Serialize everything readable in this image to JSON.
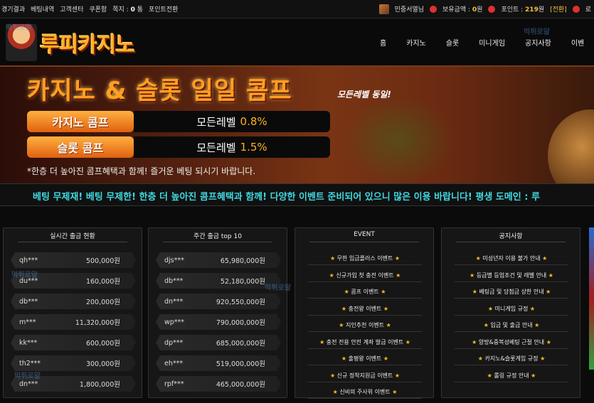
{
  "topbar": {
    "links": [
      "경기결과",
      "베팅내역",
      "고객센터",
      "쿠폰함",
      "쪽지 :"
    ],
    "notes_count": "0",
    "notes_suffix": "통",
    "points_link": "포인트전환",
    "username": "민중서열님",
    "money_label": "보유금액 :",
    "money_value": "0",
    "money_unit": "원",
    "point_label": "포인트 :",
    "point_value": "219",
    "point_unit": "원",
    "swap_label": "[전환]",
    "cut_label": "로"
  },
  "header": {
    "logo_text": "루피카지노",
    "nav": [
      "홈",
      "카지노",
      "슬롯",
      "미니게임",
      "공지사항",
      "이벤"
    ]
  },
  "banner": {
    "title": "카지노 & 슬롯 일일 콤프",
    "subtitle": "모든레벨 동일!",
    "rows": [
      {
        "label": "카지노 콤프",
        "text": "모든레벨",
        "pct": "0.8%"
      },
      {
        "label": "슬롯 콤프",
        "text": "모든레벨",
        "pct": "1.5%"
      }
    ],
    "note": "*한층 더 높아진 콤프혜택과 함께! 즐거운 베팅 되시기 바랍니다."
  },
  "marquee": {
    "text": "베팅 무제재! 베팅 무제한! 한층 더 높아진 콤프혜택과 함께! 다양한 이벤트 준비되어 있으니 많은 이용 바랍니다! 평생 도메인 : 루"
  },
  "panels": {
    "realtime": {
      "title": "실시간 출금 현황",
      "rows": [
        {
          "name": "qh***",
          "amount": "500,000원"
        },
        {
          "name": "du***",
          "amount": "160,000원"
        },
        {
          "name": "db***",
          "amount": "200,000원"
        },
        {
          "name": "m***",
          "amount": "11,320,000원"
        },
        {
          "name": "kk***",
          "amount": "600,000원"
        },
        {
          "name": "th2***",
          "amount": "300,000원"
        },
        {
          "name": "dn***",
          "amount": "1,800,000원"
        }
      ]
    },
    "weekly": {
      "title": "주간 출금 top 10",
      "rows": [
        {
          "name": "djs***",
          "amount": "65,980,000원"
        },
        {
          "name": "db***",
          "amount": "52,180,000원"
        },
        {
          "name": "dn***",
          "amount": "920,550,000원"
        },
        {
          "name": "wp***",
          "amount": "790,000,000원"
        },
        {
          "name": "dp***",
          "amount": "685,000,000원"
        },
        {
          "name": "eh***",
          "amount": "519,000,000원"
        },
        {
          "name": "rpf***",
          "amount": "465,000,000원"
        }
      ]
    },
    "event": {
      "title": "EVENT",
      "items": [
        "무한 입금플러스 이벤트",
        "신규가입 첫 충전 이벤트",
        "콤프 이벤트",
        "충전왕 이벤트",
        "지인추천 이벤트",
        "충전 전용 안전 계좌 발급 이벤트",
        "출평왕 이벤트",
        "신규 정착지원금 이벤트",
        "신비의 주사위 이벤트"
      ]
    },
    "notice": {
      "title": "공지사항",
      "items": [
        "미성년자 이용 불가 안내",
        "등급별 등업조건 및 레벨 안내",
        "베팅금 및 당첨금 상한 안내",
        "미니게임 규정",
        "입금 및 출금 안내",
        "양방&중복성베팅 근절 안내",
        "카지노&슬롯게임 규정",
        "롤링 규정 안내",
        ""
      ]
    }
  },
  "star": "★",
  "watermark": "먹튀로얄"
}
